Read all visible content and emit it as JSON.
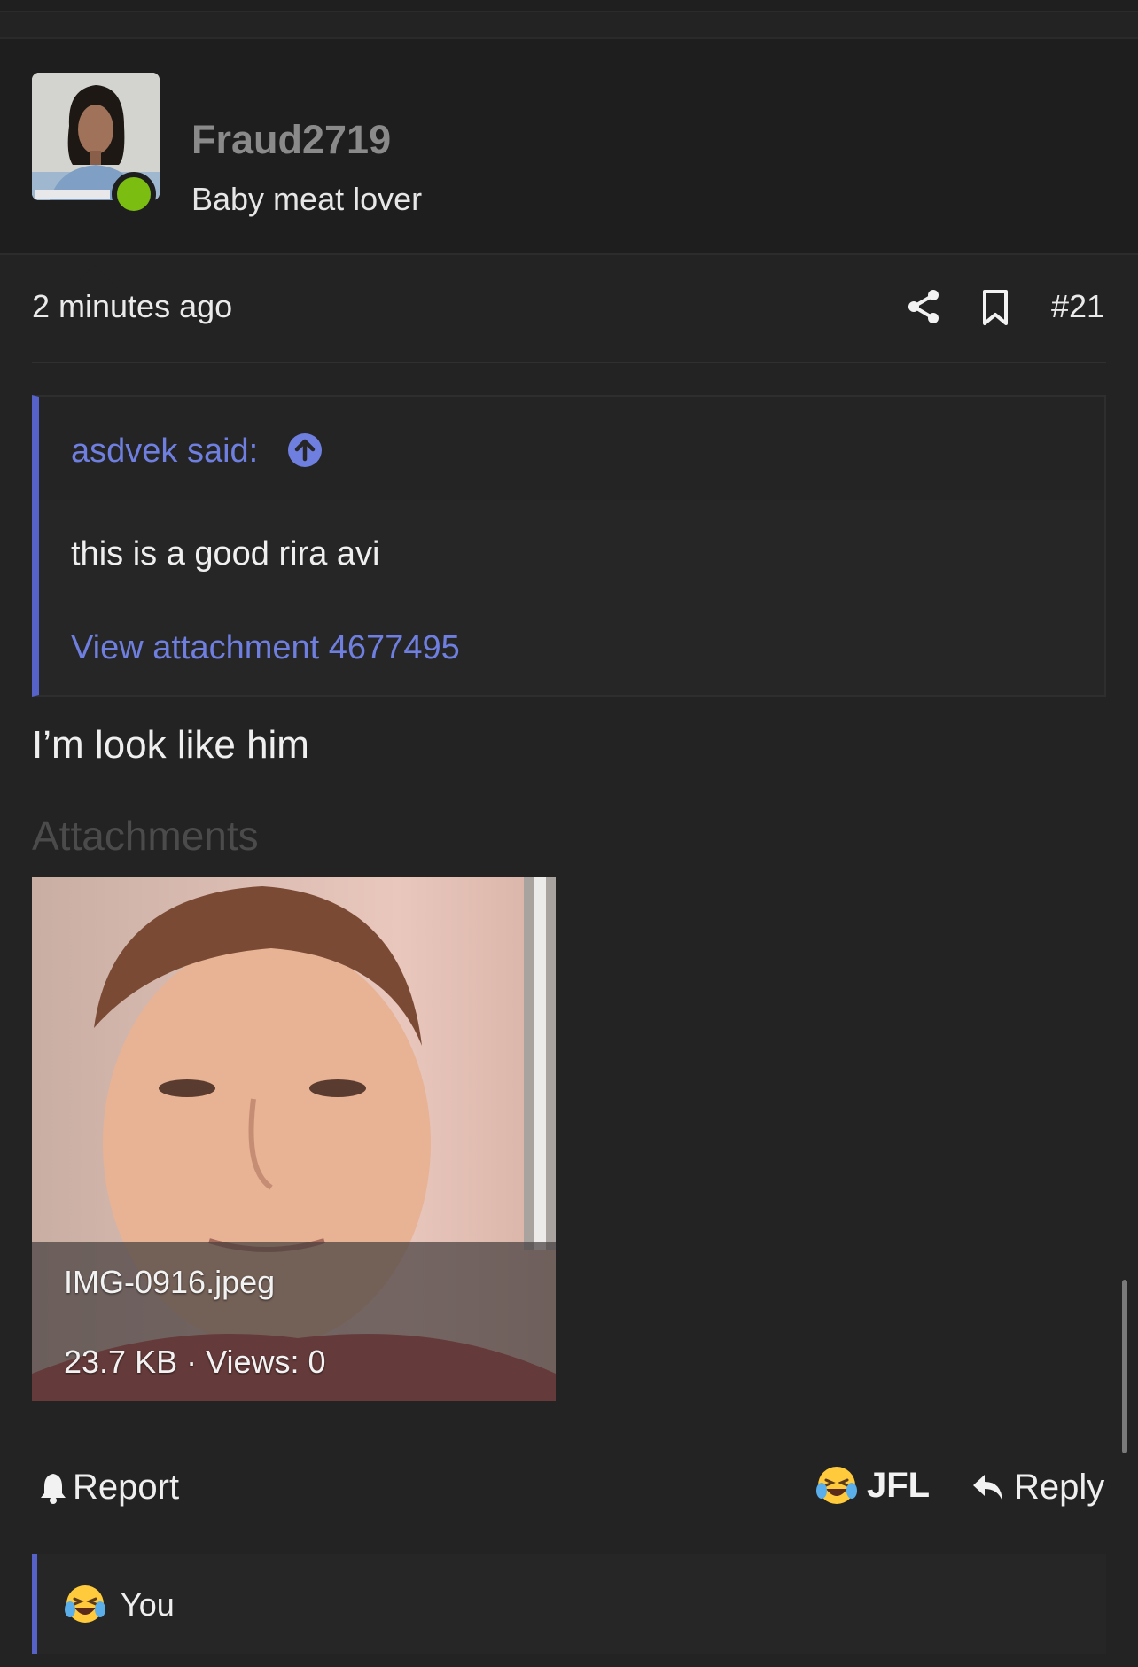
{
  "post": {
    "username": "Fraud2719",
    "user_title": "Baby meat lover",
    "time": "2 minutes ago",
    "post_number": "#21",
    "body": "I’m look like him"
  },
  "quote": {
    "author": "asdvek said:",
    "text": "this is a good rira avi",
    "link": "View attachment 4677495"
  },
  "attachments": {
    "label": "Attachments",
    "items": [
      {
        "filename": "IMG-0916.jpeg",
        "meta": "23.7 KB · Views: 0"
      }
    ]
  },
  "actions": {
    "report": "Report",
    "reaction": "JFL",
    "reply": "Reply"
  },
  "reactions": {
    "summary": "You"
  },
  "colors": {
    "accent": "#5662c7",
    "link": "#6f7fe0",
    "online": "#7cbd12",
    "background": "#232323"
  },
  "icons": [
    "share-icon",
    "bookmark-icon",
    "arrow-up-circle-icon",
    "bell-icon",
    "reply-icon",
    "laughing-crying-emoji"
  ]
}
